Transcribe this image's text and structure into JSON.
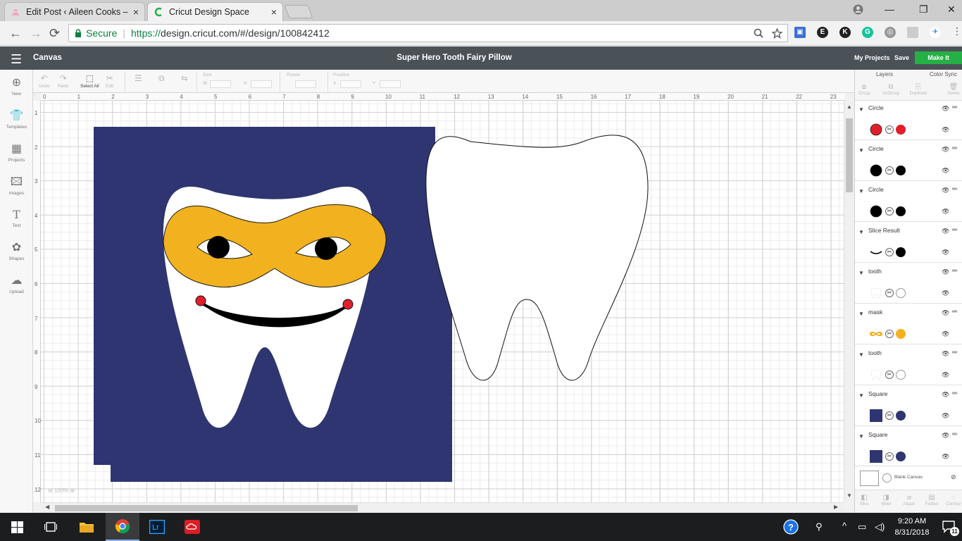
{
  "browser": {
    "tabs": [
      {
        "title": "Edit Post ‹ Aileen Cooks –",
        "active": false
      },
      {
        "title": "Cricut Design Space",
        "active": true
      }
    ],
    "tab_close": "×",
    "nav": {
      "back": "←",
      "forward": "→",
      "reload": "⟳"
    },
    "address": {
      "secure_label": "Secure",
      "url_scheme": "https://",
      "url_rest": "design.cricut.com/#/design/100842412"
    },
    "window_controls": {
      "minimize": "—",
      "maximize": "❐",
      "close": "✕"
    }
  },
  "app": {
    "canvas_label": "Canvas",
    "project_title": "Super Hero Tooth Fairy Pillow",
    "my_projects": "My Projects",
    "save": "Save",
    "make_it": "Make It"
  },
  "left_rail": [
    {
      "label": "New",
      "icon": "⊕"
    },
    {
      "label": "Templates",
      "icon": "👕"
    },
    {
      "label": "Projects",
      "icon": "▦"
    },
    {
      "label": "Images",
      "icon": "🖾"
    },
    {
      "label": "Text",
      "icon": "T"
    },
    {
      "label": "Shapes",
      "icon": "✿"
    },
    {
      "label": "Upload",
      "icon": "☁"
    }
  ],
  "toolbar": {
    "undo": "Undo",
    "redo": "Redo",
    "select_all": "Select All",
    "edit": "Edit",
    "size": "Size",
    "rotate": "Rotate",
    "position": "Position",
    "w": "W",
    "h": "H",
    "x": "X",
    "y": "Y"
  },
  "ruler": {
    "x": [
      "0",
      "1",
      "2",
      "3",
      "4",
      "5",
      "6",
      "7",
      "8",
      "9",
      "10",
      "11",
      "12",
      "13",
      "14",
      "15",
      "16",
      "17",
      "18",
      "19",
      "20",
      "21",
      "22",
      "23"
    ],
    "y": [
      "1",
      "2",
      "3",
      "4",
      "5",
      "6",
      "7",
      "8",
      "9",
      "10",
      "11",
      "12"
    ]
  },
  "zoom_level": "100%",
  "layers_panel": {
    "tab_layers": "Layers",
    "tab_color_sync": "Color Sync",
    "ops_top": [
      "Group",
      "UnGroup",
      "Duplicate",
      "Delete"
    ],
    "groups": [
      {
        "name": "Circle",
        "color": "#e11f2b",
        "thumb": "circle"
      },
      {
        "name": "Circle",
        "color": "#000000",
        "thumb": "circle"
      },
      {
        "name": "Circle",
        "color": "#000000",
        "thumb": "circle"
      },
      {
        "name": "Slice Result",
        "color": "#000000",
        "thumb": "curve"
      },
      {
        "name": "tooth",
        "color": "#ffffff",
        "thumb": "tooth"
      },
      {
        "name": "mask",
        "color": "#f2b11e",
        "thumb": "mask"
      },
      {
        "name": "tooth",
        "color": "#ffffff",
        "thumb": "tooth"
      },
      {
        "name": "Square",
        "color": "#2e3571",
        "thumb": "square"
      },
      {
        "name": "Square",
        "color": "#2e3571",
        "thumb": "square"
      }
    ],
    "blank_canvas": "Blank Canvas",
    "ops_bottom": [
      "Slice",
      "Weld",
      "Attach",
      "Flatten",
      "Contour"
    ]
  },
  "taskbar": {
    "time": "9:20 AM",
    "date": "8/31/2018",
    "notification_count": "11"
  },
  "colors": {
    "navy": "#2e3571",
    "mask_yellow": "#f2b11e",
    "cheek_red": "#e11f2b",
    "make_it_green": "#25b045",
    "header_gray": "#4b5257"
  }
}
